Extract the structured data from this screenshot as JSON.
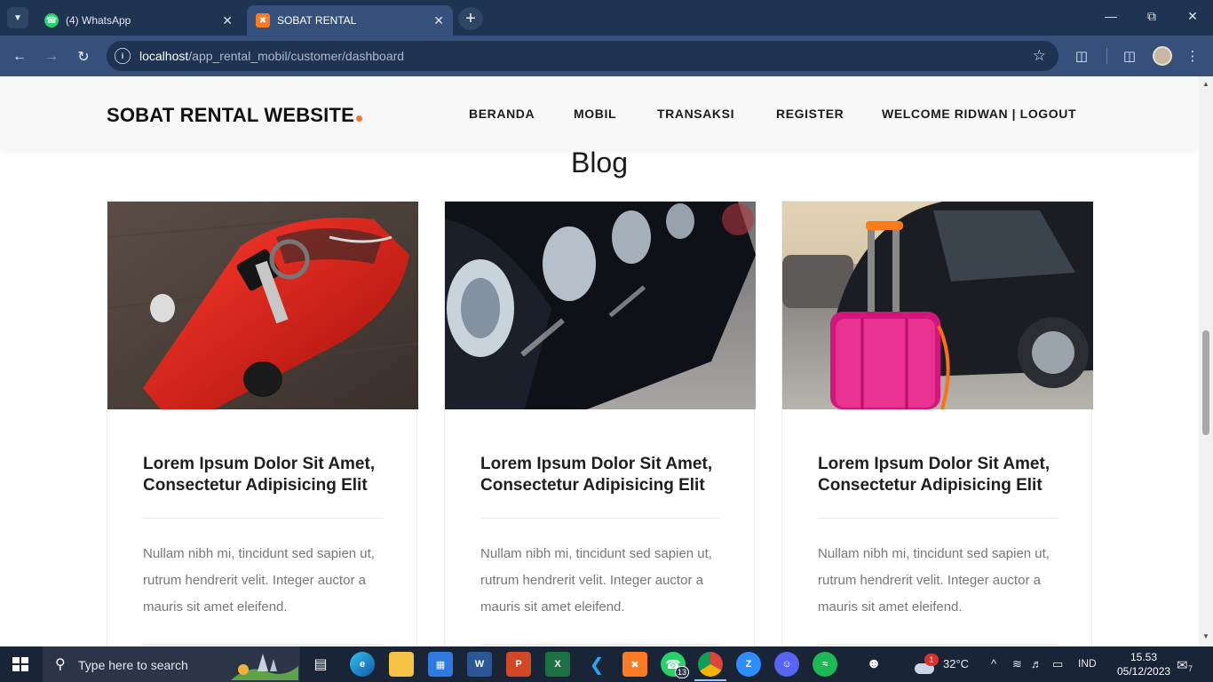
{
  "browser": {
    "tabs": [
      {
        "title": "(4) WhatsApp",
        "favicon": "whatsapp-icon",
        "active": false
      },
      {
        "title": "SOBAT RENTAL",
        "favicon": "xampp-icon",
        "active": true
      }
    ],
    "url_host": "localhost",
    "url_path": "/app_rental_mobil/customer/dashboard"
  },
  "site": {
    "brand": "SOBAT RENTAL WEBSITE",
    "brand_accent": "#f07a2d",
    "menu": [
      "BERANDA",
      "MOBIL",
      "TRANSAKSI",
      "REGISTER",
      "WELCOME RIDWAN | LOGOUT"
    ]
  },
  "blog": {
    "heading": "Blog",
    "posts": [
      {
        "image": "red-toy-car-with-key",
        "title": "Lorem Ipsum Dolor Sit Amet, Consectetur Adipisicing Elit",
        "excerpt": "Nullam nibh mi, tincidunt sed sapien ut, rutrum hendrerit velit. Integer auctor a mauris sit amet eleifend."
      },
      {
        "image": "row-of-car-headlights",
        "title": "Lorem Ipsum Dolor Sit Amet, Consectetur Adipisicing Elit",
        "excerpt": "Nullam nibh mi, tincidunt sed sapien ut, rutrum hendrerit velit. Integer auctor a mauris sit amet eleifend."
      },
      {
        "image": "pink-suitcase-by-car",
        "title": "Lorem Ipsum Dolor Sit Amet, Consectetur Adipisicing Elit",
        "excerpt": "Nullam nibh mi, tincidunt sed sapien ut, rutrum hendrerit velit. Integer auctor a mauris sit amet eleifend."
      }
    ]
  },
  "taskbar": {
    "search_placeholder": "Type here to search",
    "whatsapp_badge": "13",
    "weather_badge": "1",
    "temperature": "32°C",
    "language": "IND",
    "time": "15.53",
    "date": "05/12/2023",
    "notification_count": "7"
  }
}
